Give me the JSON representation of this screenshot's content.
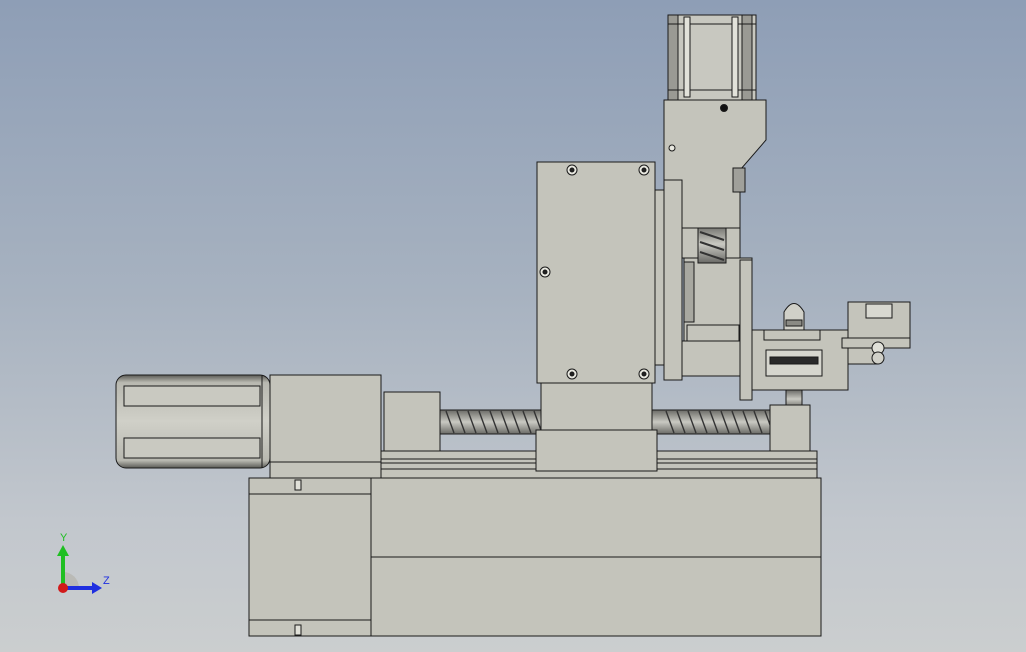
{
  "triad": {
    "y_label": "Y",
    "z_label": "Z",
    "y_color": "#1fbf22",
    "z_color": "#1f2fe0",
    "x_color": "#d11a1a"
  },
  "model": {
    "part_fill": "#c4c4bb",
    "part_edge": "#1a1a1a",
    "motor_body_fill": "#c8c8c0"
  }
}
